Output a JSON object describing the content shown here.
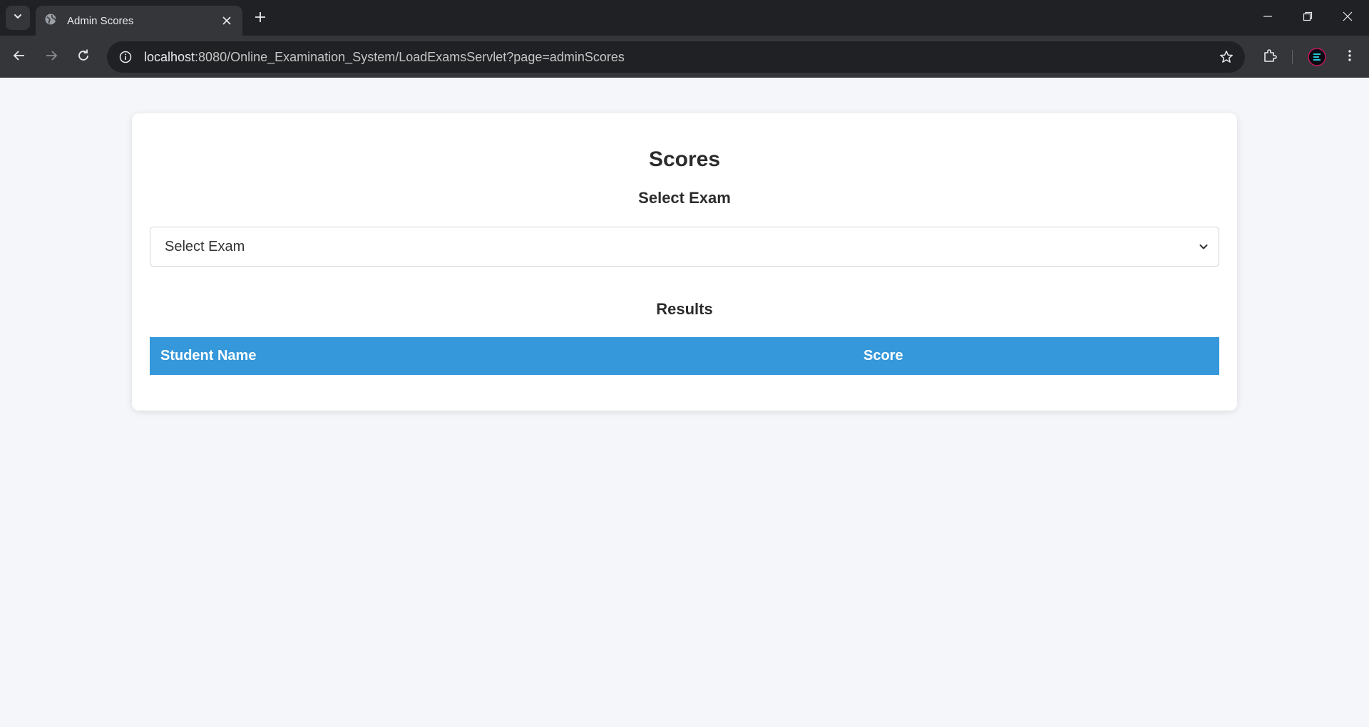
{
  "browser": {
    "tab_title": "Admin Scores",
    "url_host": "localhost",
    "url_rest": ":8080/Online_Examination_System/LoadExamsServlet?page=adminScores",
    "icons": [
      "tab-search-icon",
      "globe-icon",
      "close-icon",
      "plus-icon",
      "minimize-icon",
      "restore-icon",
      "window-close-icon",
      "back-icon",
      "forward-icon",
      "reload-icon",
      "site-info-icon",
      "star-icon",
      "extensions-icon",
      "profile-avatar",
      "more-vert-icon"
    ]
  },
  "page": {
    "title": "Scores",
    "select_heading": "Select Exam",
    "select": {
      "selected": "Select Exam"
    },
    "results_heading": "Results",
    "table": {
      "columns": [
        "Student Name",
        "Score"
      ],
      "rows": []
    }
  },
  "colors": {
    "table_header_bg": "#3498db",
    "page_bg": "#f4f6f9",
    "chrome_dark": "#202124",
    "chrome_toolbar": "#35363a"
  }
}
